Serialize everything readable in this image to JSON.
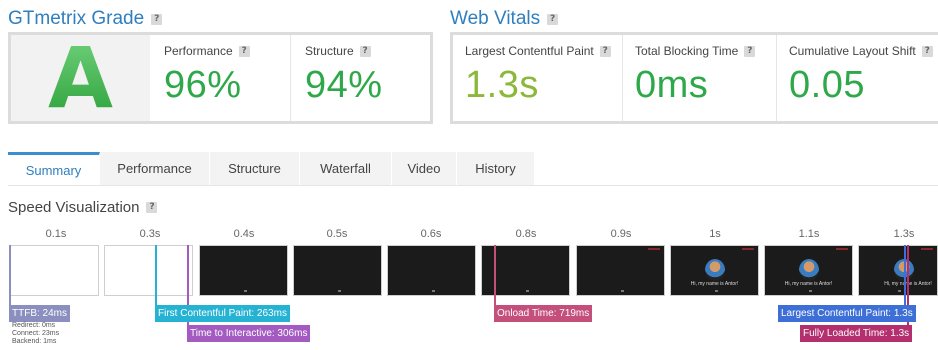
{
  "grade": {
    "title": "GTmetrix Grade",
    "help": "?",
    "letter": "A",
    "performance_label": "Performance",
    "performance_value": "96%",
    "structure_label": "Structure",
    "structure_value": "94%"
  },
  "vitals": {
    "title": "Web Vitals",
    "help": "?",
    "lcp_label": "Largest Contentful Paint",
    "lcp_value": "1.3s",
    "tbt_label": "Total Blocking Time",
    "tbt_value": "0ms",
    "cls_label": "Cumulative Layout Shift",
    "cls_value": "0.05"
  },
  "tabs": [
    "Summary",
    "Performance",
    "Structure",
    "Waterfall",
    "Video",
    "History"
  ],
  "active_tab": "Summary",
  "speed_viz": {
    "title": "Speed Visualization",
    "help": "?",
    "times": [
      "0.1s",
      "0.3s",
      "0.4s",
      "0.5s",
      "0.6s",
      "0.8s",
      "0.9s",
      "1s",
      "1.1s",
      "1.3s"
    ],
    "frame_caption": "Hi, my name is Antor!",
    "markers": {
      "ttfb": "TTFB: 24ms",
      "fcp": "First Contentful Paint: 263ms",
      "tti": "Time to Interactive: 306ms",
      "onload": "Onload Time: 719ms",
      "lcp": "Largest Contentful Paint: 1.3s",
      "fully_loaded": "Fully Loaded Time: 1.3s"
    },
    "sub_stats": {
      "redirect": "Redirect: 0ms",
      "connect": "Connect: 23ms",
      "backend": "Backend: 1ms"
    }
  },
  "colors": {
    "brand_blue": "#2f7fbf",
    "grade_green": "#2fa84a",
    "lcp_green": "#8cb83a",
    "vital_green": "#2fa84a",
    "ttfb": "#8a8fc0",
    "fcp": "#26b3d3",
    "tti": "#a35bc2",
    "onload": "#c34f7a",
    "lcp": "#3d6fd6",
    "fully_loaded": "#b32f6e"
  }
}
